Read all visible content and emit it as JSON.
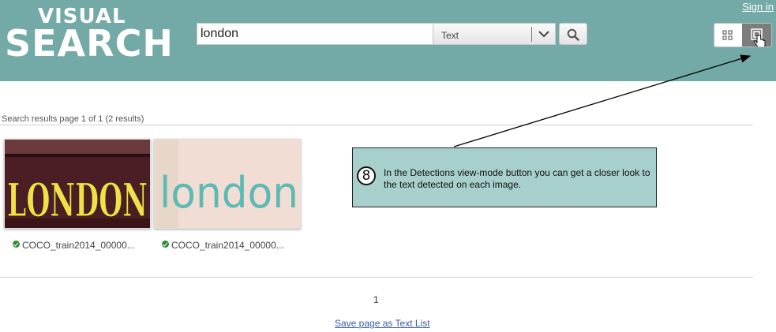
{
  "header": {
    "logo_line1": "VISUAL",
    "logo_line2": "SEARCH",
    "sign_in": "Sign in",
    "background_color": "#73aaa8"
  },
  "search": {
    "query": "london",
    "type_selected": "Text",
    "button_icon": "search-icon"
  },
  "view_modes": [
    {
      "name": "grid-view",
      "icon": "grid-icon",
      "active": false
    },
    {
      "name": "detections-view",
      "icon": "detections-icon",
      "active": true
    }
  ],
  "results": {
    "info": "Search results page 1 of 1 (2 results)",
    "items": [
      {
        "caption": "COCO_train2014_00000...",
        "status": "check-icon",
        "image_text": "LONDON"
      },
      {
        "caption": "COCO_train2014_00000...",
        "status": "check-icon",
        "image_text": "london"
      }
    ]
  },
  "pagination": {
    "current_page": "1",
    "save_link": "Save page as Text List"
  },
  "callout": {
    "number": "8",
    "text": "In the Detections view-mode button you can get a closer look to the text detected on each image.",
    "background_color": "#a7cfcb"
  }
}
